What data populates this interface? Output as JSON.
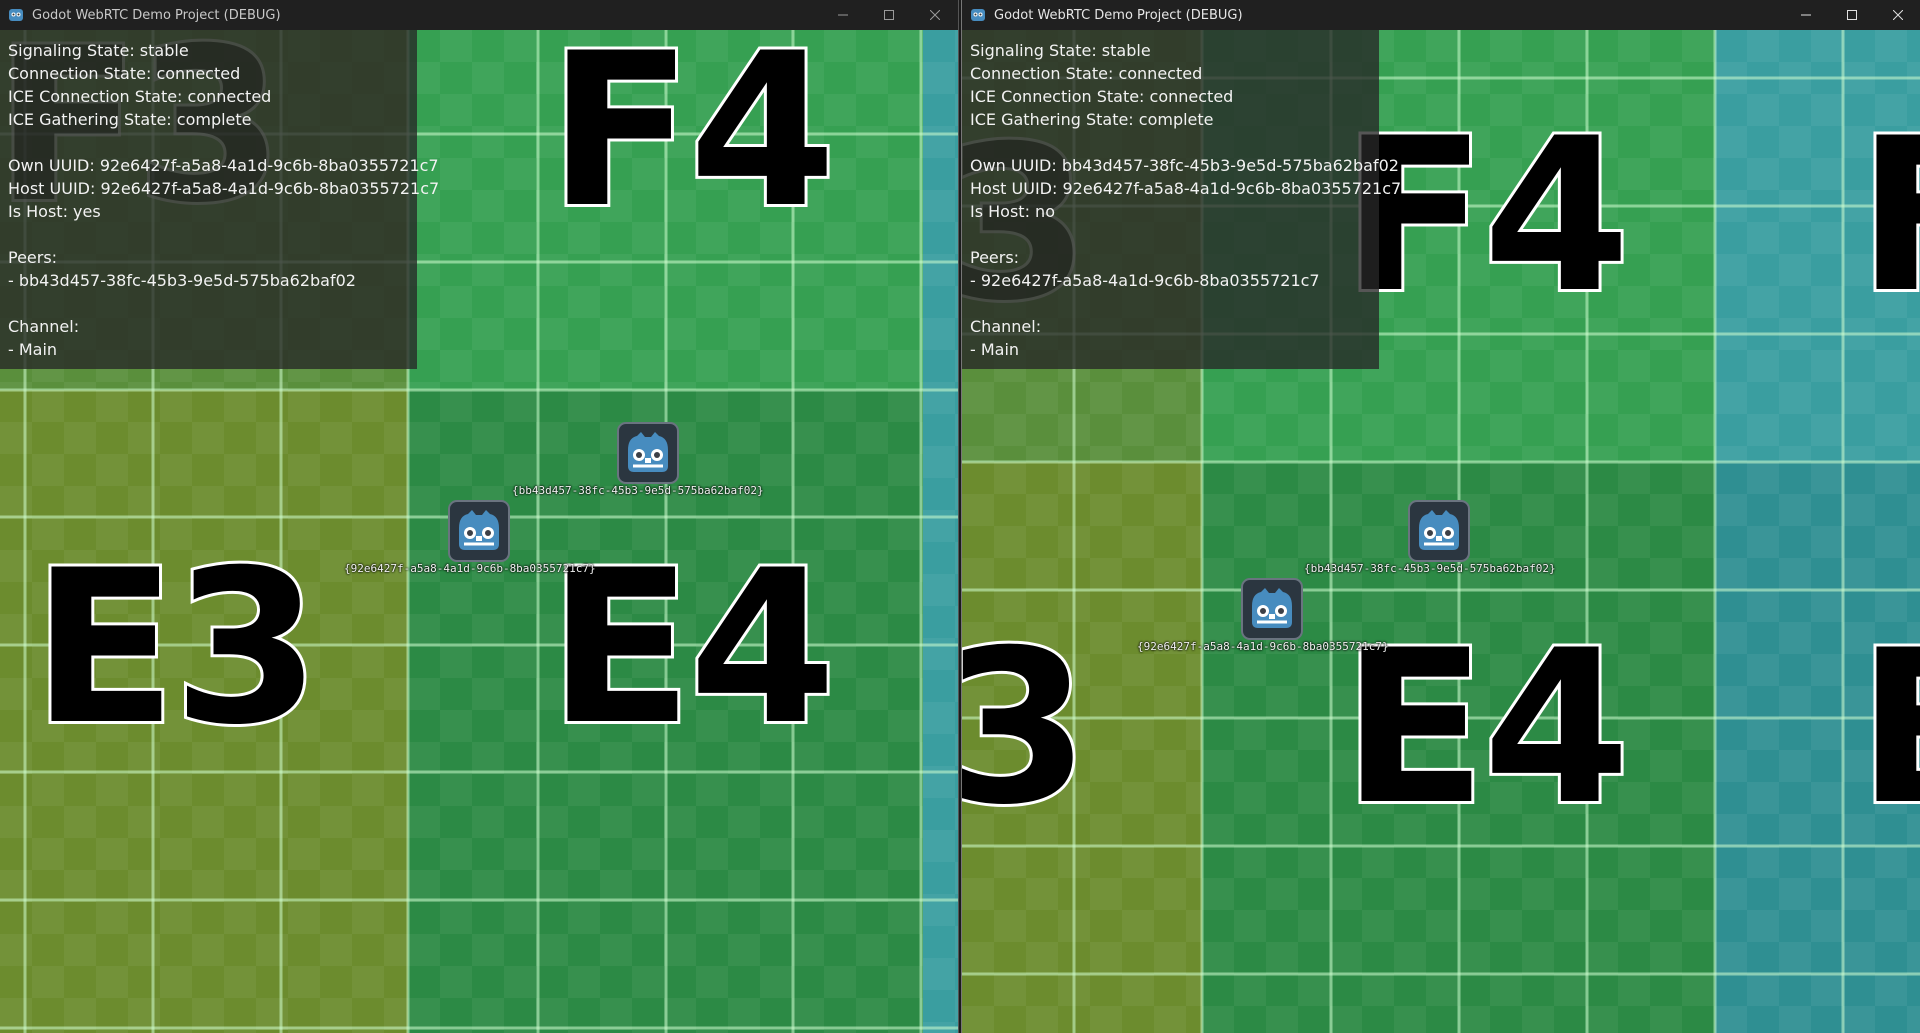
{
  "left_window": {
    "title": "Godot WebRTC Demo Project (DEBUG)",
    "info": {
      "signaling": "Signaling State: stable",
      "connection": "Connection State: connected",
      "ice_connection": "ICE Connection State: connected",
      "ice_gathering": "ICE Gathering State: complete",
      "own_uuid": "Own UUID: 92e6427f-a5a8-4a1d-9c6b-8ba0355721c7",
      "host_uuid": "Host UUID: 92e6427f-a5a8-4a1d-9c6b-8ba0355721c7",
      "is_host": "Is Host: yes",
      "peers_header": "Peers:",
      "peer_1": "- bb43d457-38fc-45b3-9e5d-575ba62baf02",
      "channel_header": "Channel:",
      "channel_1": "- Main"
    },
    "tiles": {
      "f3": "F3",
      "f4": "F4",
      "e3": "E3",
      "e4": "E4"
    },
    "players": {
      "peer": "{bb43d457-38fc-45b3-9e5d-575ba62baf02}",
      "self": "{92e6427f-a5a8-4a1d-9c6b-8ba0355721c7}"
    }
  },
  "right_window": {
    "title": "Godot WebRTC Demo Project (DEBUG)",
    "info": {
      "signaling": "Signaling State: stable",
      "connection": "Connection State: connected",
      "ice_connection": "ICE Connection State: connected",
      "ice_gathering": "ICE Gathering State: complete",
      "own_uuid": "Own UUID: bb43d457-38fc-45b3-9e5d-575ba62baf02",
      "host_uuid": "Host UUID: 92e6427f-a5a8-4a1d-9c6b-8ba0355721c7",
      "is_host": "Is Host: no",
      "peers_header": "Peers:",
      "peer_1": "- 92e6427f-a5a8-4a1d-9c6b-8ba0355721c7",
      "channel_header": "Channel:",
      "channel_1": "- Main"
    },
    "tiles": {
      "f3": "3",
      "f4": "F4",
      "f5": "F",
      "e3": "3",
      "e4": "E4",
      "e5": "E"
    },
    "players": {
      "self": "{bb43d457-38fc-45b3-9e5d-575ba62baf02}",
      "peer": "{92e6427f-a5a8-4a1d-9c6b-8ba0355721c7}"
    }
  },
  "colors": {
    "olive": "#6f8f38",
    "green": "#2f9a4a",
    "teal": "#2f9aa0",
    "titlebar": "#202020"
  },
  "icons": [
    "godot-app-icon",
    "minimize-icon",
    "maximize-icon",
    "close-icon",
    "godot-player-icon"
  ]
}
